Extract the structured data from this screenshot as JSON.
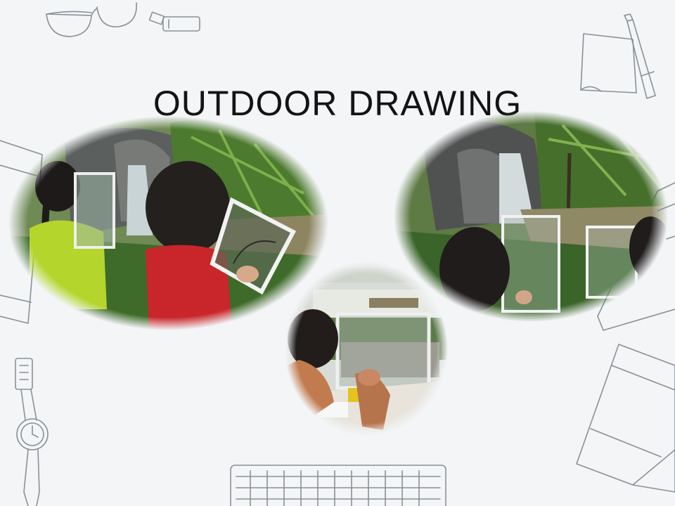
{
  "slide": {
    "title": "OUTDOOR DRAWING"
  },
  "photos": [
    {
      "name": "photo-children-drawing-waterfall-left"
    },
    {
      "name": "photo-children-drawing-waterfall-right"
    },
    {
      "name": "photo-boy-drawing-through-frame"
    }
  ],
  "doodle_icons": [
    "glasses-icon",
    "usb-drive-icon",
    "notepad-icon",
    "marker-icon",
    "smartphone-icon",
    "notebook-icon",
    "wristwatch-icon",
    "keyboard-icon",
    "journal-icon"
  ],
  "colors": {
    "background": "#f3f5f7",
    "doodle_stroke": "#8b9196",
    "title": "#141414"
  }
}
